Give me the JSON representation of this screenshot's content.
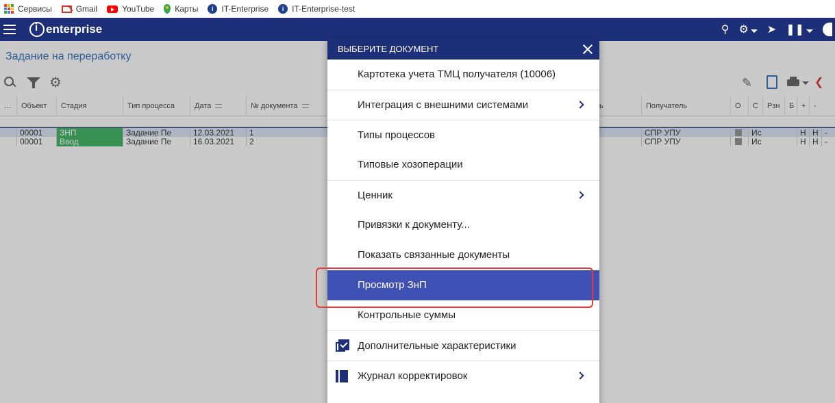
{
  "bookmarks": [
    {
      "label": "Сервисы",
      "icon": "apps-icon"
    },
    {
      "label": "Gmail",
      "icon": "gmail-icon"
    },
    {
      "label": "YouTube",
      "icon": "youtube-icon"
    },
    {
      "label": "Карты",
      "icon": "maps-icon"
    },
    {
      "label": "IT-Enterprise",
      "icon": "it-enterprise-icon"
    },
    {
      "label": "IT-Enterprise-test",
      "icon": "it-enterprise-icon"
    }
  ],
  "app": {
    "logo": "enterprise",
    "brand_color": "#1e2f7a"
  },
  "page": {
    "title": "Задание на переработку"
  },
  "grid": {
    "columns": [
      "Объект",
      "Стадия",
      "Тип процесса",
      "Дата",
      "№ документа",
      "ь",
      "Получатель",
      "О",
      "С",
      "Рзн",
      "Б",
      "+",
      "-"
    ],
    "rows": [
      {
        "obj": "00001",
        "stage": "ЗНП",
        "type": "Задание Пе",
        "date": "12.03.2021",
        "num": "1",
        "recipient": "СПР УПУ",
        "c": "Ис",
        "h1": "Н",
        "h2": "Н",
        "minus": "-"
      },
      {
        "obj": "00001",
        "stage": "Ввод",
        "type": "Задание Пе",
        "date": "16.03.2021",
        "num": "2",
        "recipient": "СПР УПУ",
        "c": "Ис",
        "h1": "Н",
        "h2": "Н",
        "minus": "-"
      }
    ]
  },
  "dialog": {
    "title": "ВЫБЕРИТЕ ДОКУМЕНТ",
    "items": [
      {
        "label": "Картотека учета ТМЦ получателя (10006)"
      },
      {
        "label": "Интеграция с внешними системами"
      },
      {
        "label": "Типы процессов"
      },
      {
        "label": "Типовые хозоперации"
      },
      {
        "label": "Ценник"
      },
      {
        "label": "Привязки к документу..."
      },
      {
        "label": "Показать связанные документы"
      },
      {
        "label": "Просмотр ЗнП"
      },
      {
        "label": "Контрольные суммы"
      },
      {
        "label": "Дополнительные характеристики"
      },
      {
        "label": "Журнал корректировок"
      }
    ]
  },
  "colors": {
    "accent": "#3f51b5",
    "stage_green": "#2fae55",
    "highlight": "#e53935",
    "title_blue": "#1e63b5"
  }
}
